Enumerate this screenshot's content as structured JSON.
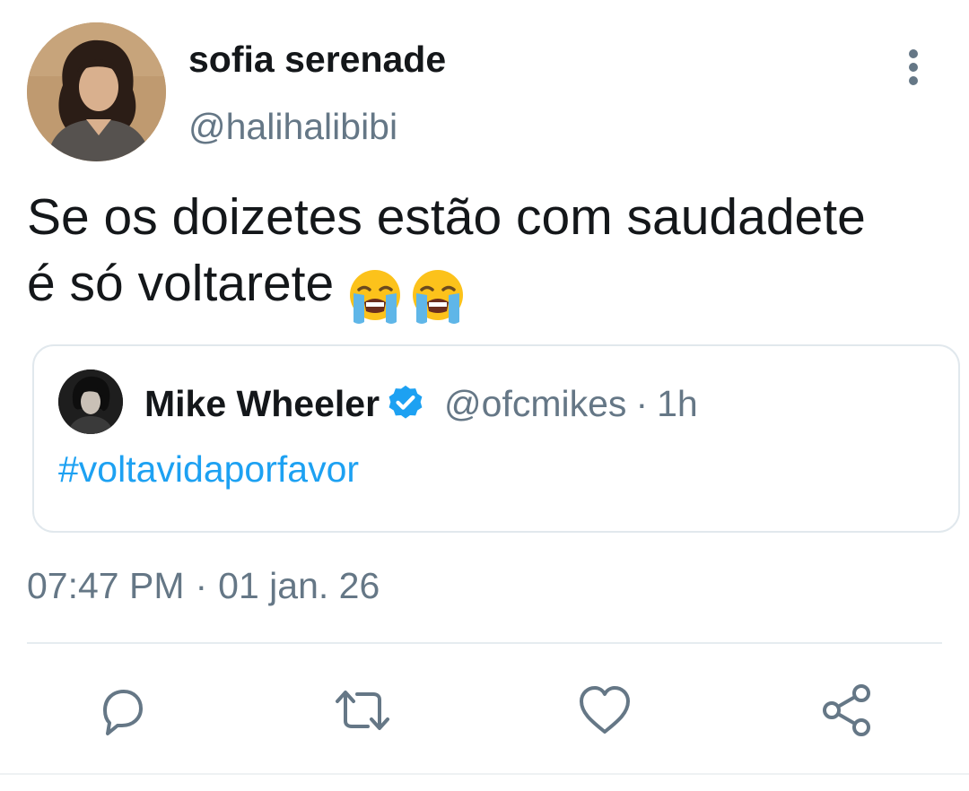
{
  "tweet": {
    "author": {
      "display_name": "sofia serenade",
      "handle": "@halihalibibi"
    },
    "text_line1": "Se os doizetes estão com saudadete",
    "text_line2": "é só voltarete",
    "emoji": "loudly-crying-face",
    "quoted": {
      "display_name": "Mike Wheeler",
      "handle": "@ofcmikes",
      "separator": "·",
      "time": "1h",
      "verified": true,
      "hashtag": "#voltavidaporfavor"
    },
    "time": "07:47 PM",
    "meta_separator": "·",
    "date": "01 jan. 26"
  },
  "actions": {
    "reply_icon": "reply-icon",
    "retweet_icon": "retweet-icon",
    "like_icon": "heart-icon",
    "share_icon": "share-icon"
  },
  "colors": {
    "text": "#14171a",
    "secondary": "#657786",
    "link": "#1da1f2",
    "border": "#e1e8ed",
    "verified": "#1da1f2"
  }
}
